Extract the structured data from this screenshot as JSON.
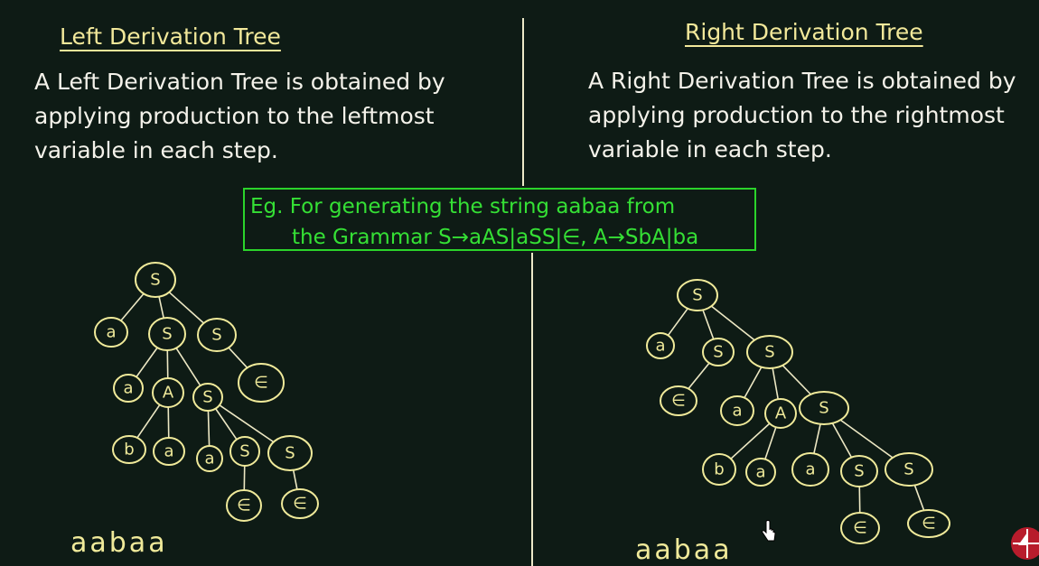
{
  "left": {
    "heading": "Left Derivation Tree",
    "paragraph": [
      "A Left Derivation Tree is obtained by",
      "applying production to the leftmost",
      "variable in each step."
    ],
    "yield": "aabaa"
  },
  "right": {
    "heading": "Right Derivation Tree",
    "paragraph": [
      "A Right Derivation Tree is obtained by",
      "applying production to the rightmost",
      "variable in each step."
    ],
    "yield": "aabaa"
  },
  "example": {
    "line1": "Eg.  For generating the string aabaa from",
    "line2": "the Grammar S→aAS|aSS|∈,  A→SbA|ba"
  },
  "trees": {
    "left": {
      "nodes": [
        {
          "id": "S0",
          "label": "S"
        },
        {
          "id": "a1",
          "label": "a"
        },
        {
          "id": "S1",
          "label": "S"
        },
        {
          "id": "S2",
          "label": "S"
        },
        {
          "id": "e1",
          "label": "∈"
        },
        {
          "id": "a2",
          "label": "a"
        },
        {
          "id": "A1",
          "label": "A"
        },
        {
          "id": "S3",
          "label": "S"
        },
        {
          "id": "b1",
          "label": "b"
        },
        {
          "id": "a3",
          "label": "a"
        },
        {
          "id": "a4",
          "label": "a"
        },
        {
          "id": "S4",
          "label": "S"
        },
        {
          "id": "S5",
          "label": "S"
        },
        {
          "id": "e2",
          "label": "∈"
        },
        {
          "id": "e3",
          "label": "∈"
        }
      ],
      "edges": [
        [
          "S0",
          "a1"
        ],
        [
          "S0",
          "S1"
        ],
        [
          "S0",
          "S2"
        ],
        [
          "S2",
          "e1"
        ],
        [
          "S1",
          "a2"
        ],
        [
          "S1",
          "A1"
        ],
        [
          "S1",
          "S3"
        ],
        [
          "A1",
          "b1"
        ],
        [
          "A1",
          "a3"
        ],
        [
          "S3",
          "a4"
        ],
        [
          "S3",
          "S4"
        ],
        [
          "S3",
          "S5"
        ],
        [
          "S4",
          "e2"
        ],
        [
          "S5",
          "e3"
        ]
      ]
    },
    "right": {
      "nodes": [
        {
          "id": "S0",
          "label": "S"
        },
        {
          "id": "a1",
          "label": "a"
        },
        {
          "id": "S1",
          "label": "S"
        },
        {
          "id": "S2",
          "label": "S"
        },
        {
          "id": "e1",
          "label": "∈"
        },
        {
          "id": "a2",
          "label": "a"
        },
        {
          "id": "A1",
          "label": "A"
        },
        {
          "id": "S3",
          "label": "S"
        },
        {
          "id": "b1",
          "label": "b"
        },
        {
          "id": "a3",
          "label": "a"
        },
        {
          "id": "a4",
          "label": "a"
        },
        {
          "id": "S4",
          "label": "S"
        },
        {
          "id": "S5",
          "label": "S"
        },
        {
          "id": "e2",
          "label": "∈"
        },
        {
          "id": "e3",
          "label": "∈"
        }
      ],
      "edges": [
        [
          "S0",
          "a1"
        ],
        [
          "S0",
          "S1"
        ],
        [
          "S0",
          "S2"
        ],
        [
          "S1",
          "e1"
        ],
        [
          "S2",
          "a2"
        ],
        [
          "S2",
          "A1"
        ],
        [
          "S2",
          "S3"
        ],
        [
          "A1",
          "b1"
        ],
        [
          "A1",
          "a3"
        ],
        [
          "S3",
          "a4"
        ],
        [
          "S3",
          "S4"
        ],
        [
          "S3",
          "S5"
        ],
        [
          "S4",
          "e2"
        ],
        [
          "S5",
          "e3"
        ]
      ]
    }
  },
  "colors": {
    "background": "#0e1b15",
    "chalk_text": "#f4f2ea",
    "chalk_yellow": "#f0ea9a",
    "example_green": "#35e035"
  },
  "icons": {
    "cursor": "hand-pointer-icon",
    "logo": "red-circle-logo-icon"
  }
}
